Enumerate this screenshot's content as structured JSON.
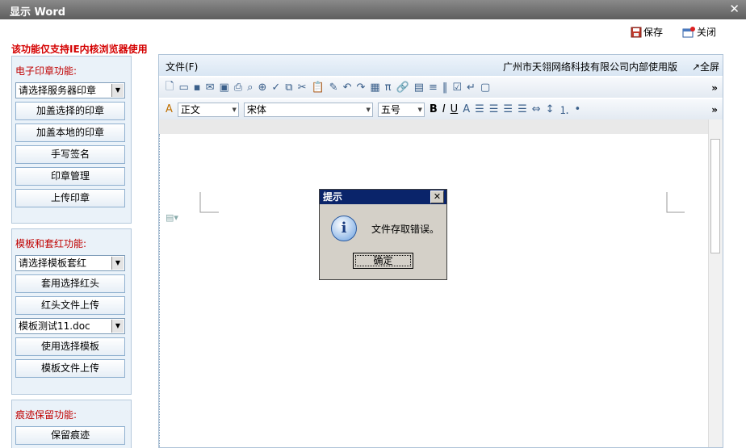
{
  "window": {
    "title": "显示 Word"
  },
  "top_actions": {
    "save": "保存",
    "close": "关闭"
  },
  "notice": "该功能仅支持IE内核浏览器使用",
  "panels": {
    "seal": {
      "heading": "电子印章功能:",
      "select_value": "请选择服务器印章",
      "buttons": [
        "加盖选择的印章",
        "加盖本地的印章",
        "手写签名",
        "印章管理",
        "上传印章"
      ]
    },
    "template": {
      "heading": "模板和套红功能:",
      "select1_value": "请选择模板套红",
      "buttons1": [
        "套用选择红头",
        "红头文件上传"
      ],
      "select2_value": "模板测试11.doc",
      "buttons2": [
        "使用选择模板",
        "模板文件上传"
      ]
    },
    "trace": {
      "heading": "痕迹保留功能:",
      "buttons": [
        "保留痕迹"
      ]
    }
  },
  "editor": {
    "menu_file": "文件(F)",
    "company": "广州市天翎网络科技有限公司内部使用版",
    "fullscreen": "↗全屏",
    "style_value": "正文",
    "font_value": "宋体",
    "size_value": "五号"
  },
  "dialog": {
    "title": "提示",
    "close_glyph": "✕",
    "icon_glyph": "i",
    "message": "文件存取错误。",
    "ok": "确定"
  }
}
